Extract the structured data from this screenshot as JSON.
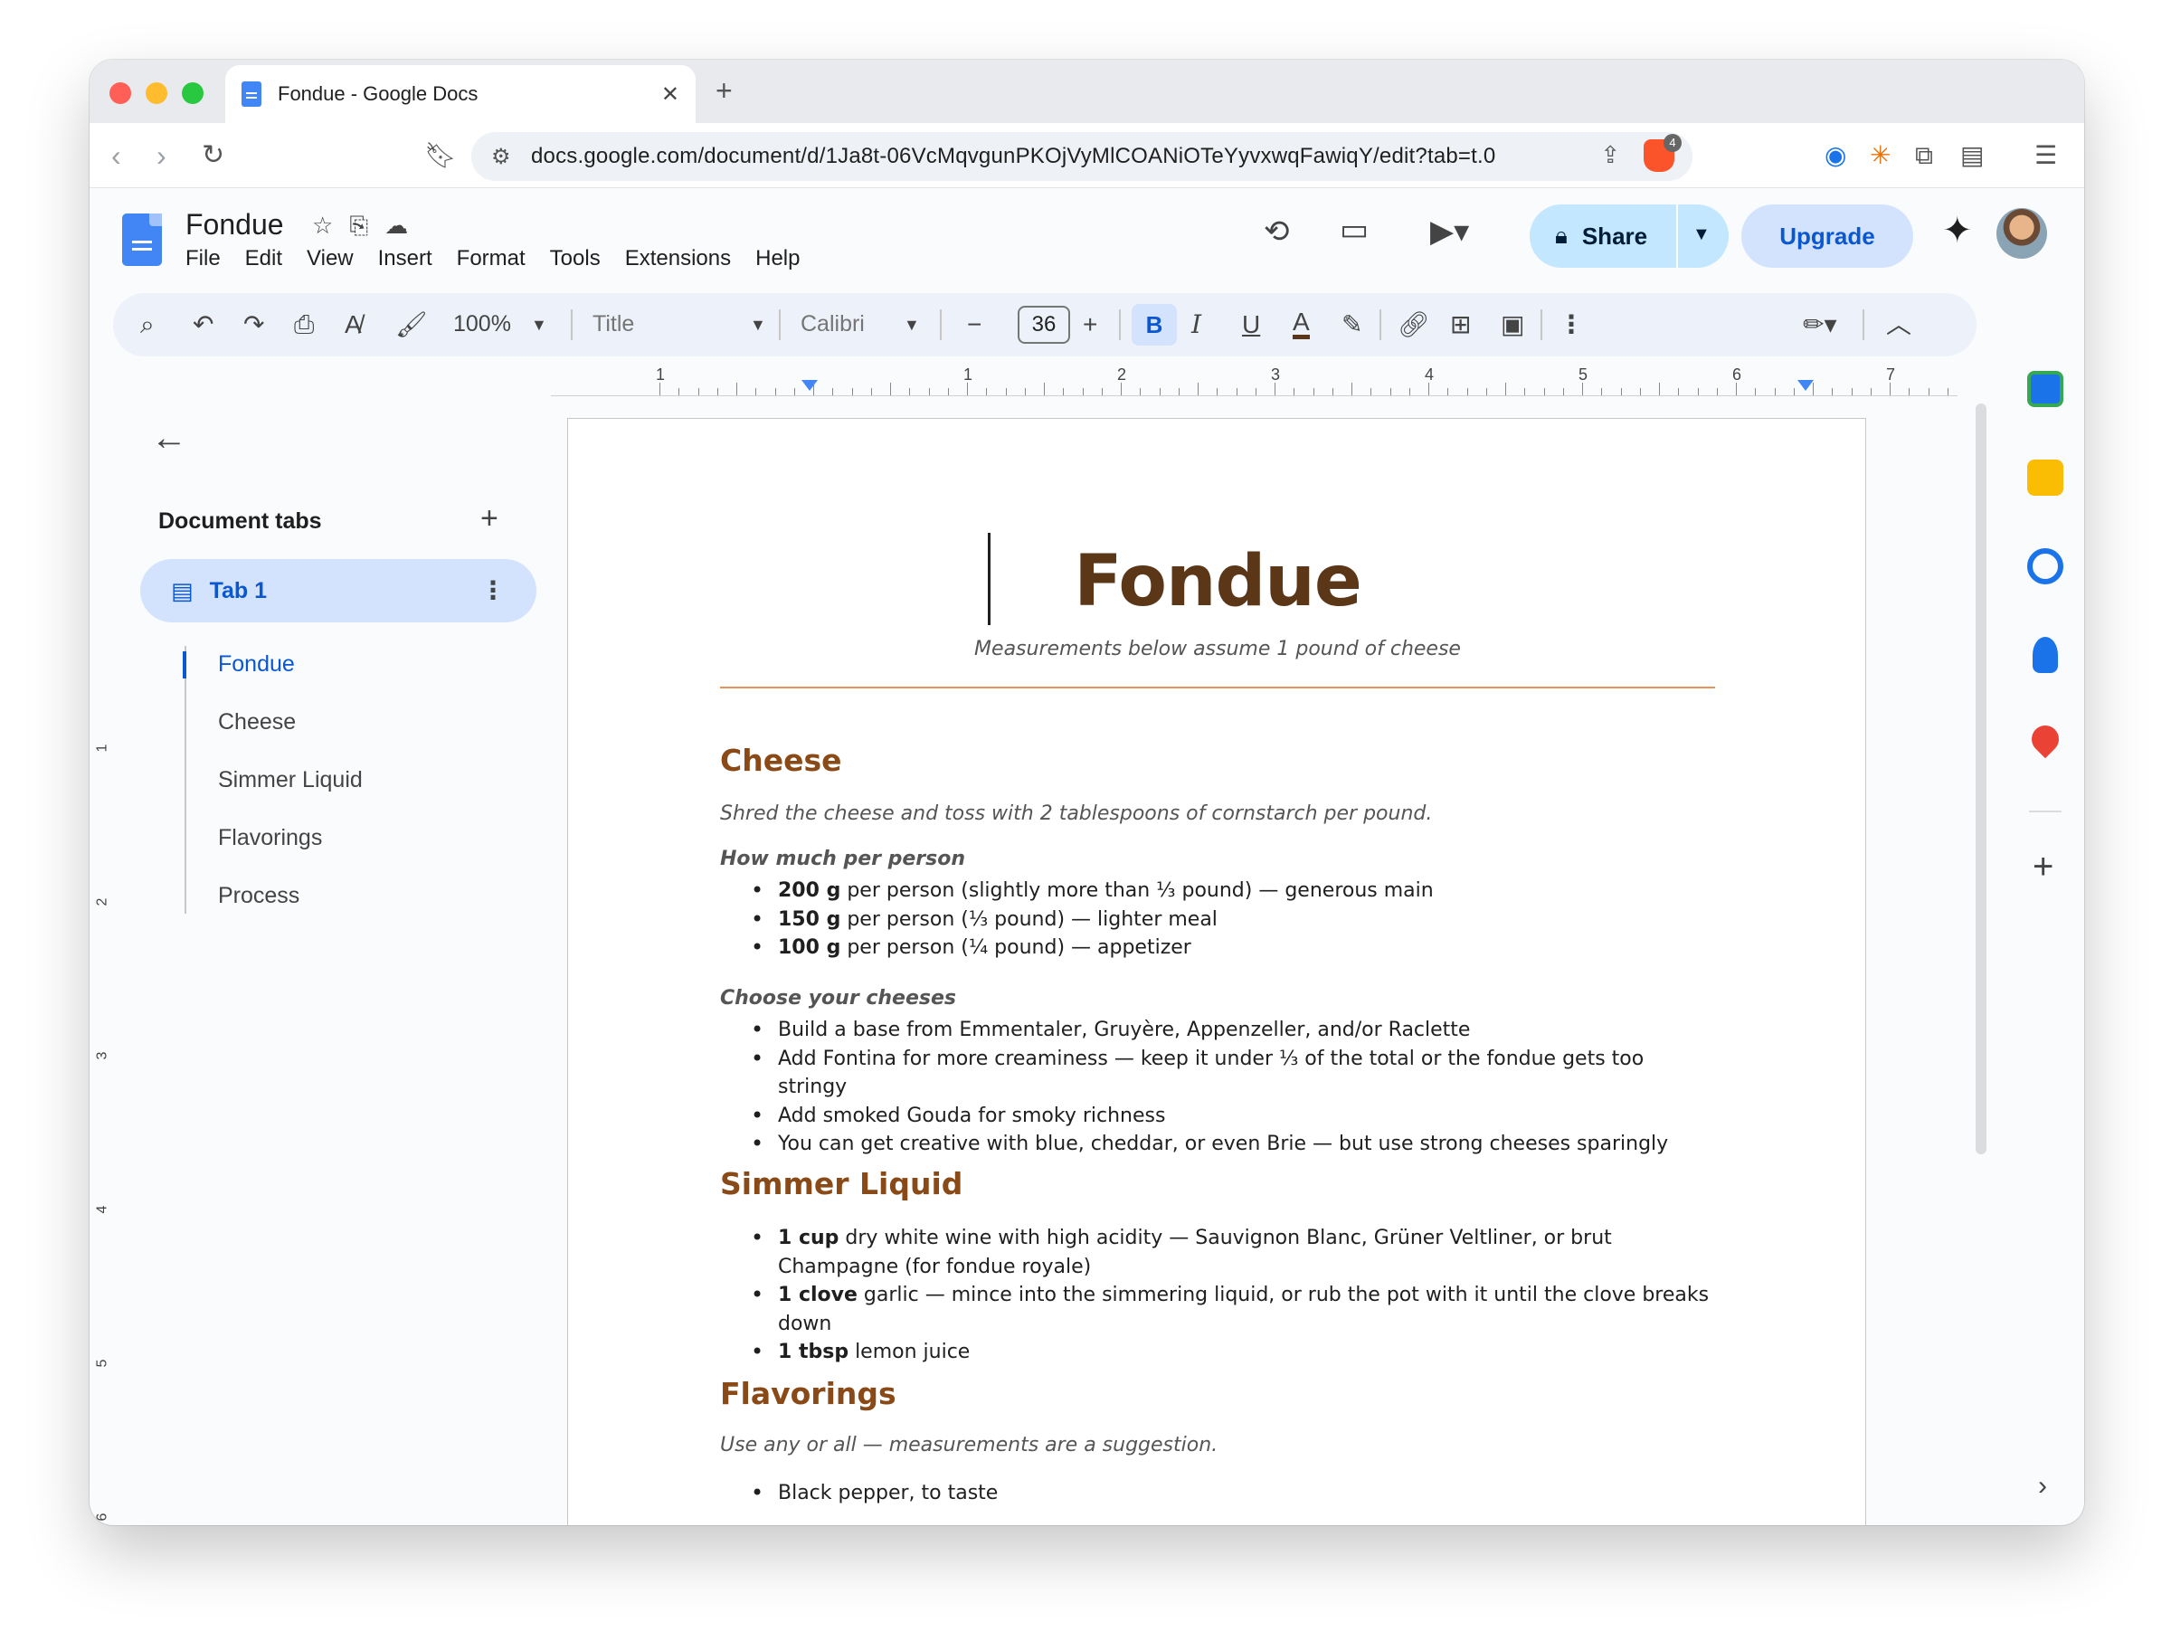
{
  "browser": {
    "tab_title": "Fondue - Google Docs",
    "url": "docs.google.com/document/d/1Ja8t-06VcMqvgunPKOjVyMlCOANiOTeYyvxwqFawiqY/edit?tab=t.0",
    "extension_badge": "4"
  },
  "docs_header": {
    "doc_title": "Fondue",
    "menu": [
      "File",
      "Edit",
      "View",
      "Insert",
      "Format",
      "Tools",
      "Extensions",
      "Help"
    ],
    "share_label": "Share",
    "upgrade_label": "Upgrade"
  },
  "toolbar": {
    "zoom": "100%",
    "style": "Title",
    "font": "Calibri",
    "font_size": "36",
    "bold_label": "B",
    "italic_label": "I",
    "underline_label": "U",
    "text_color_label": "A"
  },
  "ruler": {
    "numbers": [
      "1",
      "1",
      "2",
      "3",
      "4",
      "5",
      "6",
      "7"
    ],
    "vertical_numbers": [
      "1",
      "2",
      "3",
      "4",
      "5",
      "6"
    ]
  },
  "outline": {
    "heading": "Document tabs",
    "tab_label": "Tab 1",
    "items": [
      "Fondue",
      "Cheese",
      "Simmer Liquid",
      "Flavorings",
      "Process"
    ],
    "active_item": "Fondue"
  },
  "document": {
    "title": "Fondue",
    "subtitle": "Measurements below assume 1 pound of cheese",
    "sections": {
      "cheese": {
        "heading": "Cheese",
        "note": "Shred the cheese and toss with 2 tablespoons of cornstarch per pound.",
        "subhead1": "How much per person",
        "list1": [
          {
            "bold": "200 g",
            "text": " per person (slightly more than ⅓ pound) — generous main"
          },
          {
            "bold": "150 g",
            "text": " per person (⅓ pound) — lighter meal"
          },
          {
            "bold": "100 g",
            "text": " per person (¼ pound) — appetizer"
          }
        ],
        "subhead2": "Choose your cheeses",
        "list2": [
          "Build a base from Emmentaler, Gruyère, Appenzeller, and/or Raclette",
          "Add Fontina for more creaminess — keep it under ⅓ of the total or the fondue gets too stringy",
          "Add smoked Gouda for smoky richness",
          "You can get creative with blue, cheddar, or even Brie — but use strong cheeses sparingly"
        ]
      },
      "simmer": {
        "heading": "Simmer Liquid",
        "list": [
          {
            "bold": "1 cup",
            "text": " dry white wine with high acidity — Sauvignon Blanc, Grüner Veltliner, or brut Champagne (for fondue royale)"
          },
          {
            "bold": "1 clove",
            "text": " garlic — mince into the simmering liquid, or rub the pot with it until the clove breaks down"
          },
          {
            "bold": "1 tbsp",
            "text": " lemon juice"
          }
        ]
      },
      "flavorings": {
        "heading": "Flavorings",
        "note": "Use any or all — measurements are a suggestion.",
        "list": [
          "Black pepper, to taste"
        ]
      }
    }
  },
  "colors": {
    "title_brown": "#5b3718",
    "heading_brown": "#8a4a17",
    "accent_blue": "#0b57d0",
    "share_bg": "#c2e7ff",
    "rule_orange": "#e8935c"
  }
}
